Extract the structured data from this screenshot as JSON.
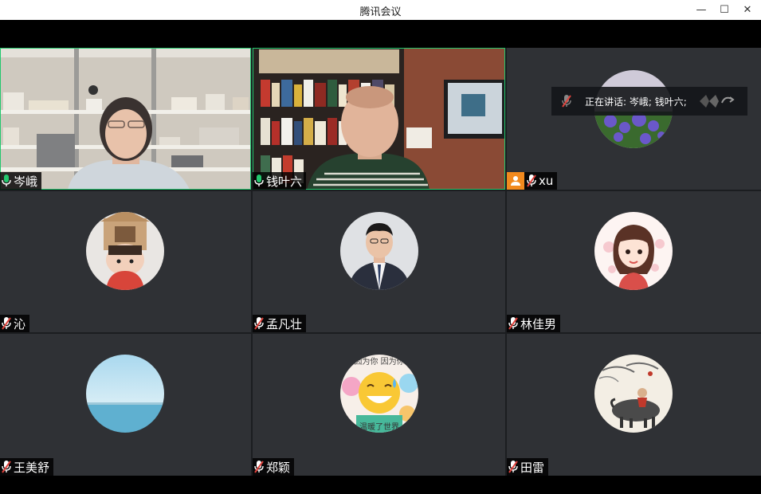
{
  "window": {
    "title": "腾讯会议",
    "minimize_glyph": "—",
    "maximize_glyph": "☐",
    "close_glyph": "✕"
  },
  "speaking": {
    "label": "正在讲话: 岑峨; 钱叶六;"
  },
  "colors": {
    "tile_bg": "#2f3135",
    "active_border": "#22c76d",
    "mic_on": "#22c76d",
    "mic_muted": "#e0423c",
    "orange_badge": "#f28a1e"
  },
  "participants": [
    {
      "name": "岑峨",
      "mic": "on",
      "video": true
    },
    {
      "name": "钱叶六",
      "mic": "on",
      "video": true
    },
    {
      "name": "xu",
      "mic": "muted",
      "video": false,
      "host_badge": true
    },
    {
      "name": "沁",
      "mic": "muted",
      "video": false
    },
    {
      "name": "孟凡壮",
      "mic": "muted",
      "video": false
    },
    {
      "name": "林佳男",
      "mic": "muted",
      "video": false
    },
    {
      "name": "王美舒",
      "mic": "muted",
      "video": false
    },
    {
      "name": "郑颖",
      "mic": "muted",
      "video": false
    },
    {
      "name": "田雷",
      "mic": "muted",
      "video": false
    }
  ],
  "avatar_text": {
    "emoji_top": "因为你 因为你",
    "emoji_bottom": "温暖了世界"
  }
}
